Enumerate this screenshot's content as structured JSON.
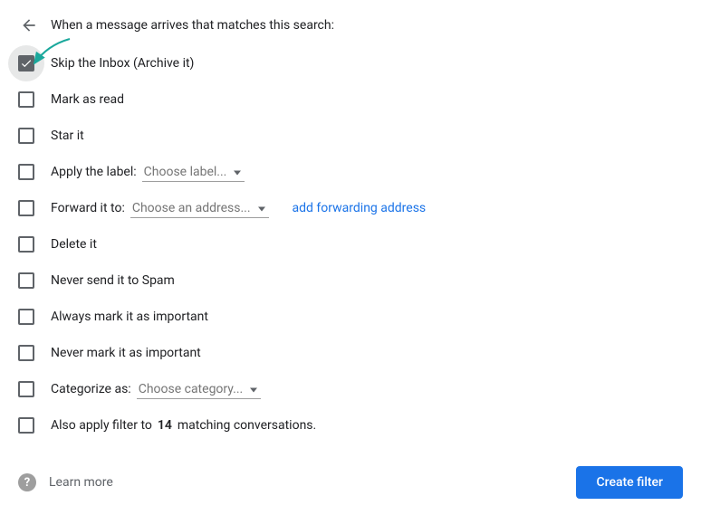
{
  "header": {
    "title": "When a message arrives that matches this search:"
  },
  "options": {
    "skip_inbox": {
      "label": "Skip the Inbox (Archive it)",
      "checked": true,
      "highlighted": true
    },
    "mark_read": {
      "label": "Mark as read",
      "checked": false
    },
    "star": {
      "label": "Star it",
      "checked": false
    },
    "apply_label": {
      "label": "Apply the label:",
      "dropdown": "Choose label...",
      "checked": false
    },
    "forward": {
      "label": "Forward it to:",
      "dropdown": "Choose an address...",
      "link": "add forwarding address",
      "checked": false
    },
    "delete": {
      "label": "Delete it",
      "checked": false
    },
    "never_spam": {
      "label": "Never send it to Spam",
      "checked": false
    },
    "always_important": {
      "label": "Always mark it as important",
      "checked": false
    },
    "never_important": {
      "label": "Never mark it as important",
      "checked": false
    },
    "categorize": {
      "label": "Categorize as:",
      "dropdown": "Choose category...",
      "checked": false
    },
    "also_apply": {
      "prefix": "Also apply filter to ",
      "count": "14",
      "suffix": " matching conversations.",
      "checked": false
    }
  },
  "footer": {
    "learn_more": "Learn more",
    "create_button": "Create filter"
  }
}
